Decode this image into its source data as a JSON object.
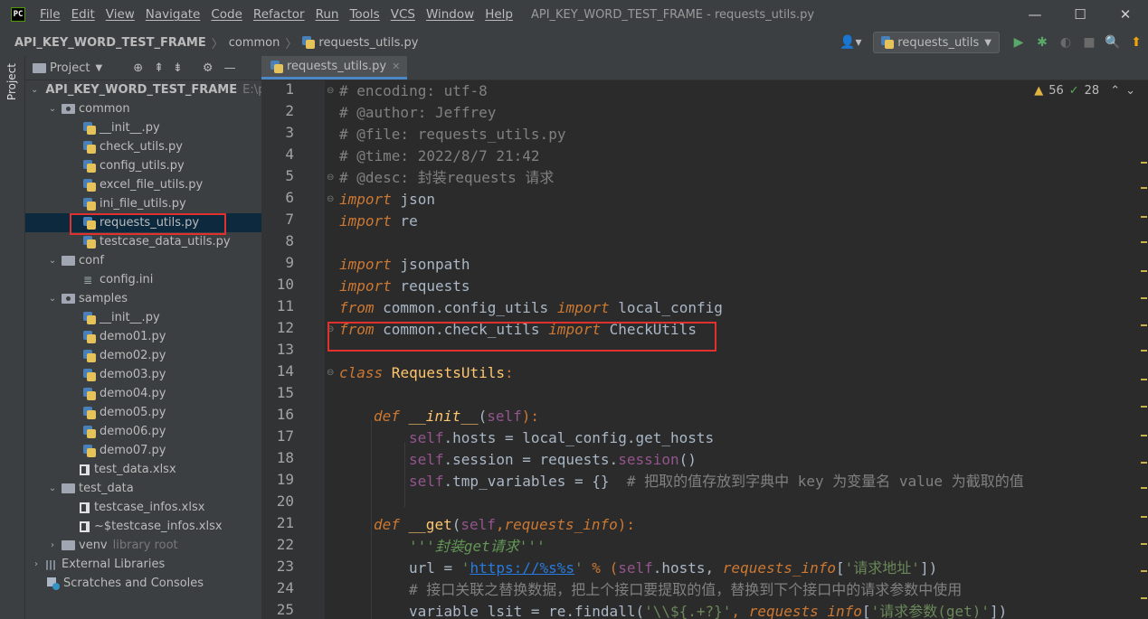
{
  "menubar": {
    "items": [
      "File",
      "Edit",
      "View",
      "Navigate",
      "Code",
      "Refactor",
      "Run",
      "Tools",
      "VCS",
      "Window",
      "Help"
    ],
    "window_title": "API_KEY_WORD_TEST_FRAME - requests_utils.py",
    "controls": {
      "minimize": "—",
      "maximize": "☐",
      "close": "✕"
    }
  },
  "navbar": {
    "project": "API_KEY_WORD_TEST_FRAME",
    "folder": "common",
    "file": "requests_utils.py",
    "run_config": "requests_utils"
  },
  "project_panel": {
    "title": "Project",
    "root": {
      "name": "API_KEY_WORD_TEST_FRAME",
      "path": "E:\\p"
    },
    "folders": {
      "common": {
        "name": "common",
        "files": [
          "__init__.py",
          "check_utils.py",
          "config_utils.py",
          "excel_file_utils.py",
          "ini_file_utils.py",
          "requests_utils.py",
          "testcase_data_utils.py"
        ]
      },
      "conf": {
        "name": "conf",
        "files": [
          "config.ini"
        ]
      },
      "samples": {
        "name": "samples",
        "files": [
          "__init__.py",
          "demo01.py",
          "demo02.py",
          "demo03.py",
          "demo04.py",
          "demo05.py",
          "demo06.py",
          "demo07.py",
          "test_data.xlsx"
        ]
      },
      "test_data": {
        "name": "test_data",
        "files": [
          "testcase_infos.xlsx",
          "~$testcase_infos.xlsx"
        ]
      },
      "venv": {
        "name": "venv",
        "note": "library root"
      }
    },
    "external_libraries": "External Libraries",
    "scratches": "Scratches and Consoles",
    "side_label": "Project"
  },
  "editor": {
    "tab": "requests_utils.py",
    "inspection": {
      "warnings": "56",
      "ok": "28"
    },
    "line_numbers": [
      "1",
      "2",
      "3",
      "4",
      "5",
      "6",
      "7",
      "8",
      "9",
      "10",
      "11",
      "12",
      "13",
      "14",
      "15",
      "16",
      "17",
      "18",
      "19",
      "20",
      "21",
      "22",
      "23",
      "24",
      "25"
    ],
    "lines": {
      "l1": "# encoding: utf-8",
      "l2": "# @author: Jeffrey",
      "l3": "# @file: requests_utils.py",
      "l4": "# @time: 2022/8/7 21:42",
      "l5": "# @desc: 封装requests 请求",
      "import": "import",
      "from": "from",
      "json": " json",
      "re": " re",
      "jsonpath": " jsonpath",
      "requests": " requests",
      "mod_config": " common.config_utils ",
      "local_config": " local_config",
      "mod_check": " common.check_utils ",
      "check_utils_cls": " CheckUtils",
      "class_kw": "class",
      "class_name": " RequestsUtils",
      "colon": ":",
      "def": "def",
      "init": " __init__",
      "get": " __get",
      "self": "self",
      "hosts_l": ".hosts = local_config.get_hosts",
      "session_l1": ".session = requests.",
      "session_l2": "session",
      "session_l3": "()",
      "tmp_l": ".tmp_variables = {}  ",
      "tmp_cm": "# 把取的值存放到字典中 key 为变量名 value 为截取的值",
      "get_p1": "(",
      "get_p2": ",",
      "get_param": "requests_info",
      "get_p3": "):",
      "doc": "'''封装get请求'''",
      "url_l1": "url = ",
      "url_str1": "'",
      "url_link": "https://%s%s",
      "url_str2": "'",
      "url_l2": " % (",
      "url_l3": ".hosts, ",
      "url_l4": "[",
      "url_key": "'请求地址'",
      "url_l5": "])",
      "l24": "# 接口关联之替换数据，把上个接口要提取的值，替换到下个接口中的请求参数中使用",
      "l25a": "variable_lsit = re.findall(",
      "l25b": "'\\\\${.+?}'",
      "l25c": ", ",
      "l25d": "[",
      "l25e": "'请求参数(get)'",
      "l25f": "])"
    }
  },
  "colors": {
    "highlight": "#e0312f",
    "accent": "#4a88c7"
  }
}
